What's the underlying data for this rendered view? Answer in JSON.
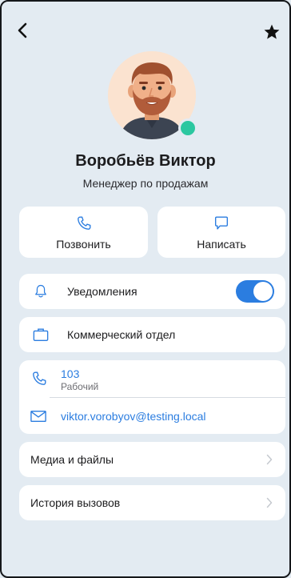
{
  "contact": {
    "name": "Воробьёв Виктор",
    "position": "Менеджер по продажам",
    "status": "online"
  },
  "actions": {
    "call_label": "Позвонить",
    "message_label": "Написать"
  },
  "notifications": {
    "label": "Уведомления",
    "enabled": true
  },
  "department": {
    "label": "Коммерческий отдел"
  },
  "phone": {
    "number": "103",
    "type": "Рабочий"
  },
  "email": {
    "address": "viktor.vorobyov@testing.local"
  },
  "menu": {
    "media_label": "Медиа и файлы",
    "calls_label": "История вызовов"
  },
  "colors": {
    "accent": "#2b7de0",
    "online": "#2bc7a0",
    "background": "#e3ebf2"
  },
  "icons": {
    "back": "chevron-left-icon",
    "favorite": "star-icon",
    "call": "phone-icon",
    "message": "chat-bubble-icon",
    "notifications": "bell-icon",
    "department": "briefcase-icon",
    "email": "envelope-icon",
    "row_arrow": "chevron-right-icon"
  }
}
